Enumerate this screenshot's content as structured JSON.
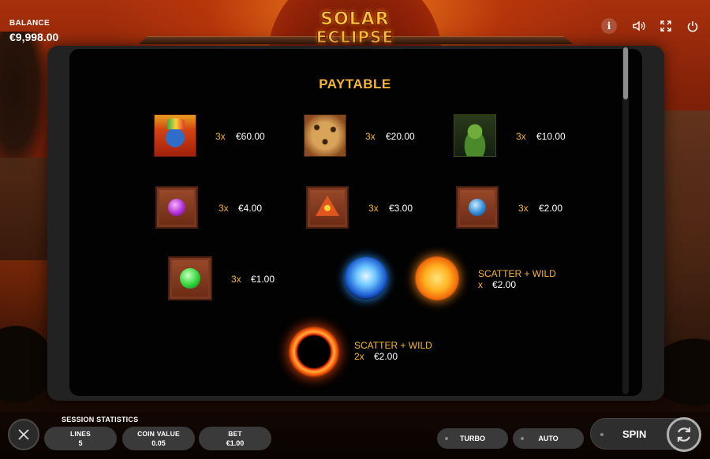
{
  "hud": {
    "balance_label": "BALANCE",
    "balance_value": "€9,998.00",
    "logo_line1": "SOLAR",
    "logo_line2": "ECLIPSE",
    "icons": [
      "info-icon",
      "sound-icon",
      "fullscreen-icon",
      "power-icon"
    ]
  },
  "paytable": {
    "title": "PAYTABLE",
    "rows": [
      {
        "symbol": "warrior",
        "multiplier": "3x",
        "payout": "€60.00"
      },
      {
        "symbol": "jaguar",
        "multiplier": "3x",
        "payout": "€20.00"
      },
      {
        "symbol": "snake",
        "multiplier": "3x",
        "payout": "€10.00"
      },
      {
        "symbol": "purple-gem",
        "multiplier": "3x",
        "payout": "€4.00"
      },
      {
        "symbol": "red-triangle",
        "multiplier": "3x",
        "payout": "€3.00"
      },
      {
        "symbol": "blue-gem",
        "multiplier": "3x",
        "payout": "€2.00"
      },
      {
        "symbol": "green-gem",
        "multiplier": "3x",
        "payout": "€1.00"
      }
    ],
    "scatter_sun": {
      "label": "SCATTER + WILD",
      "multiplier": "x",
      "payout": "€2.00"
    },
    "scatter_eclipse": {
      "label": "SCATTER + WILD",
      "multiplier": "2x",
      "payout": "€2.00"
    }
  },
  "bottom": {
    "session_label": "SESSION STATISTICS",
    "stats": [
      {
        "label": "LINES",
        "value": "5"
      },
      {
        "label": "COIN VALUE",
        "value": "0.05"
      },
      {
        "label": "BET",
        "value": "€1.00"
      }
    ],
    "turbo_label": "TURBO",
    "auto_label": "AUTO",
    "spin_label": "SPIN"
  },
  "colors": {
    "accent": "#f6b531",
    "panel": "#020202"
  }
}
